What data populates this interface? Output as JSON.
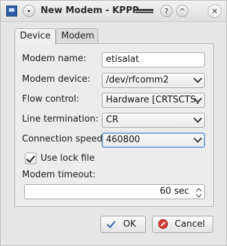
{
  "window": {
    "title": "New Modem - KPPP",
    "help_button": "?",
    "minimize_button": "^"
  },
  "tabs": [
    {
      "label": "Device",
      "active": true
    },
    {
      "label": "Modem",
      "active": false
    }
  ],
  "form": {
    "modem_name_label": "Modem name:",
    "modem_name_value": "etisalat",
    "modem_device_label": "Modem device:",
    "modem_device_value": "/dev/rfcomm2",
    "flow_control_label": "Flow control:",
    "flow_control_value": "Hardware [CRTSCTS]",
    "line_termination_label": "Line termination:",
    "line_termination_value": "CR",
    "connection_speed_label": "Connection speed:",
    "connection_speed_value": "460800",
    "use_lock_file_label": "Use lock file",
    "use_lock_file_checked": true,
    "modem_timeout_label": "Modem timeout:",
    "modem_timeout_value": "60 sec"
  },
  "buttons": {
    "ok": "OK",
    "cancel": "Cancel"
  },
  "icons": {
    "app": "kppp-app-icon",
    "help": "help-icon",
    "minimize": "minimize-icon",
    "ok": "check-icon",
    "cancel": "cancel-icon"
  }
}
